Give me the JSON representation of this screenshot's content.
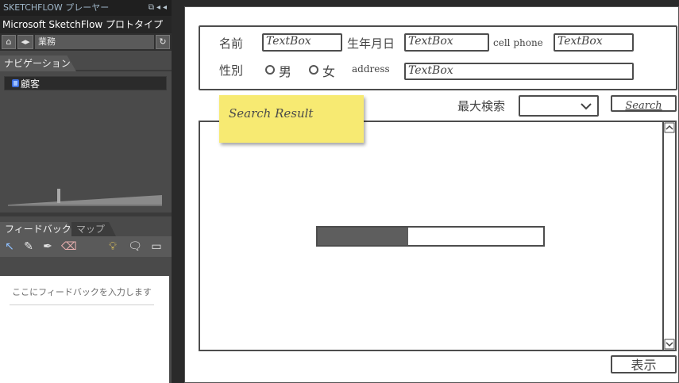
{
  "player": {
    "title": "SKETCHFLOW プレーヤー",
    "project_name": "Microsoft SketchFlow プロトタイプ",
    "breadcrumb": "業務",
    "navigation_tab": "ナビゲーション",
    "nav_items": [
      {
        "label": "顧客",
        "icon": "screen-icon"
      }
    ],
    "feedback_tab": "フィードバック",
    "map_tab": "マップ",
    "feedback_placeholder": "ここにフィードバックを入力します",
    "zoom_level": 0.33
  },
  "form": {
    "name_label": "名前",
    "name_value": "TextBox",
    "birthdate_label": "生年月日",
    "birthdate_value": "TextBox",
    "cellphone_label": "cell phone",
    "cellphone_value": "TextBox",
    "gender_label": "性別",
    "gender_options": [
      "男",
      "女"
    ],
    "address_label": "address",
    "address_value": "TextBox"
  },
  "search": {
    "sticky_note": "Search Result",
    "max_results_label": "最大検索",
    "max_results_value": "",
    "search_button": "Search",
    "progress": 0.4,
    "show_button": "表示"
  },
  "colors": {
    "sticky": "#f7ea72",
    "progress_fill": "#5e5e5e",
    "accent_blue": "#3d6fe0"
  }
}
